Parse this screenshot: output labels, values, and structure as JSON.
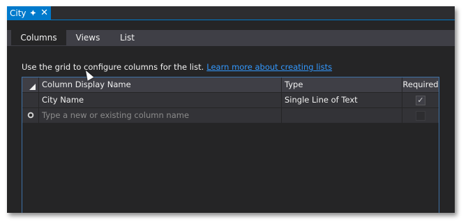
{
  "document_tab": {
    "title": "City",
    "pin_icon": "pin-icon",
    "close_icon": "close-icon"
  },
  "tabs": [
    {
      "label": "Columns",
      "active": true
    },
    {
      "label": "Views",
      "active": false
    },
    {
      "label": "List",
      "active": false
    }
  ],
  "info": {
    "text": "Use the grid to configure columns for the list.",
    "link": "Learn more about creating lists"
  },
  "grid": {
    "columns": [
      "Column Display Name",
      "Type",
      "Required"
    ],
    "rows": [
      {
        "name": "City Name",
        "type": "Single Line of Text",
        "required": true
      }
    ],
    "new_row_placeholder": "Type a new or existing column name"
  },
  "colors": {
    "accent": "#007acc",
    "background": "#252526",
    "link": "#3399ff"
  }
}
